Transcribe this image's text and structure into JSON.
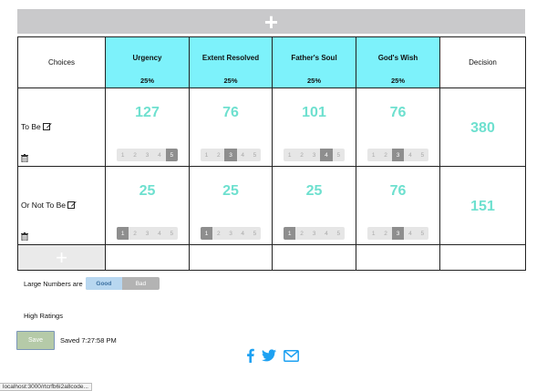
{
  "toolbar": {
    "add_column_icon": "plus-icon",
    "add_column_label": "+"
  },
  "table": {
    "choices_header": "Choices",
    "decision_header": "Decision",
    "criteria": [
      {
        "name": "Urgency",
        "weight": "25%"
      },
      {
        "name": "Extent Resolved",
        "weight": "25%"
      },
      {
        "name": "Father's Soul",
        "weight": "25%"
      },
      {
        "name": "God's Wish",
        "weight": "25%"
      }
    ],
    "rating_levels": [
      "1",
      "2",
      "3",
      "4",
      "5"
    ],
    "rows": [
      {
        "choice": "To Be",
        "scores": [
          "127",
          "76",
          "101",
          "76"
        ],
        "selected": [
          5,
          3,
          4,
          3
        ],
        "decision": "380"
      },
      {
        "choice": "Or Not To Be",
        "scores": [
          "25",
          "25",
          "25",
          "76"
        ],
        "selected": [
          1,
          1,
          1,
          3
        ],
        "decision": "151"
      }
    ],
    "add_row_label": "+"
  },
  "preferences": {
    "large_numbers_label": "Large Numbers are",
    "options": [
      "Good",
      "Bad"
    ],
    "selected": "Good",
    "high_ratings_label": "High Ratings"
  },
  "save": {
    "button_label": "Save",
    "status": "Saved 7:27:58 PM"
  },
  "share": {
    "icons": [
      "facebook-icon",
      "twitter-icon",
      "mail-icon"
    ],
    "accent": "#1da1f2"
  },
  "statusbar": {
    "url": "localhost:3000/rtcrfb6i2a8code..."
  },
  "colors": {
    "criteria_header": "#7df2fb",
    "score_text": "#6ee0cf",
    "add_bar": "#c9c9cb"
  }
}
